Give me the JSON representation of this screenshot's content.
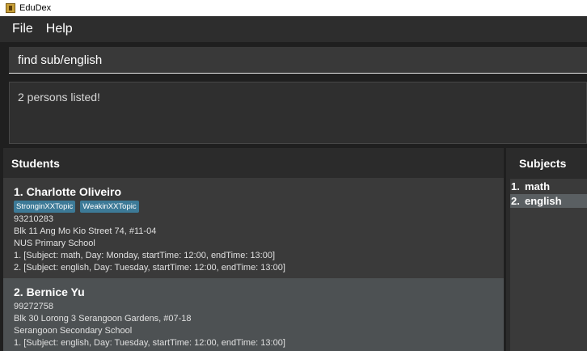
{
  "window": {
    "title": "EduDex"
  },
  "menu": {
    "file": "File",
    "help": "Help"
  },
  "command": {
    "value": "find sub/english"
  },
  "result": {
    "text": "2 persons listed!"
  },
  "students": {
    "header": "Students",
    "list": [
      {
        "name": "1. Charlotte Oliveiro",
        "tags": [
          "StronginXXTopic",
          "WeakinXXTopic"
        ],
        "phone": "93210283",
        "address": "Blk 11 Ang Mo Kio Street 74, #11-04",
        "school": "NUS Primary School",
        "lessons": [
          "1. [Subject: math, Day: Monday, startTime: 12:00, endTime: 13:00]",
          "2. [Subject: english, Day: Tuesday, startTime: 12:00, endTime: 13:00]"
        ]
      },
      {
        "name": "2. Bernice Yu",
        "tags": [],
        "phone": "99272758",
        "address": "Blk 30 Lorong 3 Serangoon Gardens, #07-18",
        "school": "Serangoon Secondary School",
        "lessons": [
          "1. [Subject: english, Day: Tuesday, startTime: 12:00, endTime: 13:00]"
        ]
      }
    ]
  },
  "subjects": {
    "header": "Subjects",
    "items": [
      {
        "number": "1.",
        "name": "math",
        "selected": false
      },
      {
        "number": "2.",
        "name": "english",
        "selected": true
      }
    ]
  }
}
